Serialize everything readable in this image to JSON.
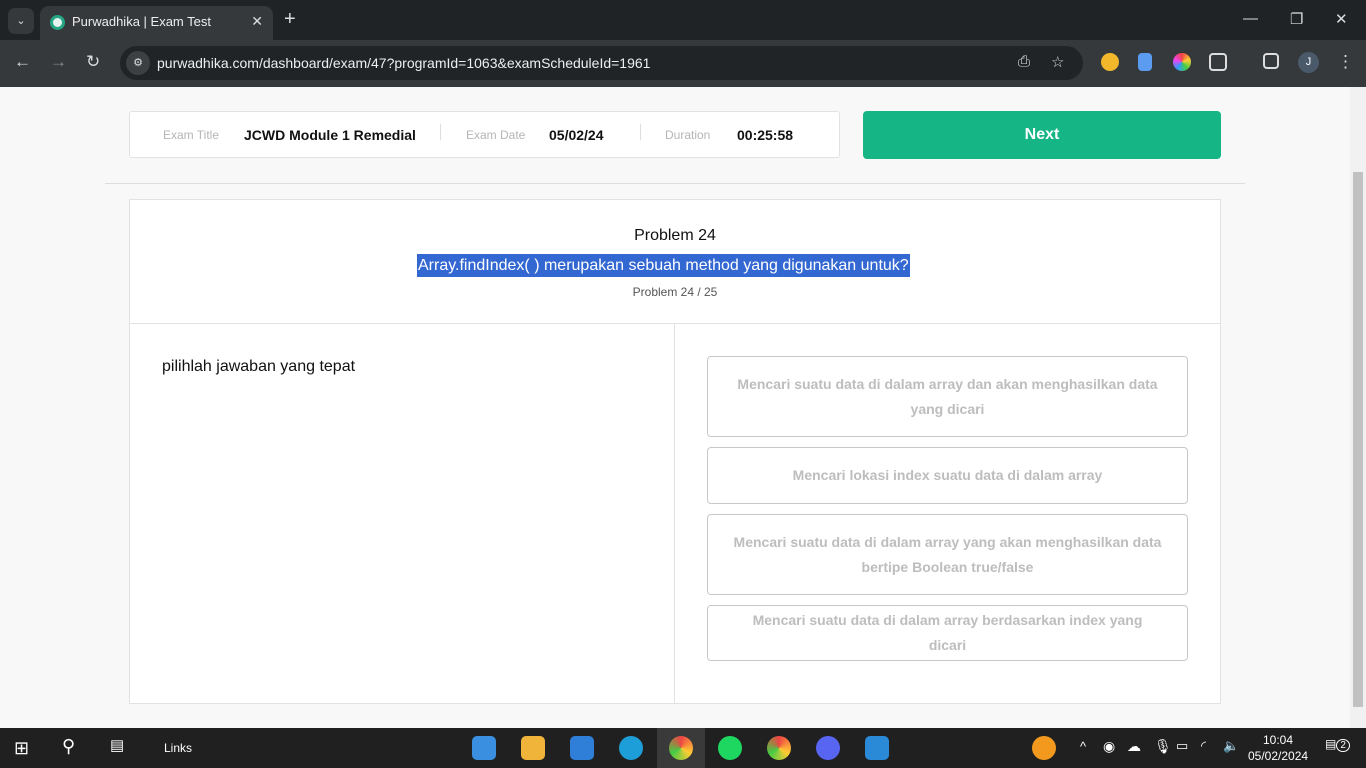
{
  "browser": {
    "tab_title": "Purwadhika | Exam Test",
    "url": "purwadhika.com/dashboard/exam/47?programId=1063&examScheduleId=1961",
    "profile_initial": "J"
  },
  "exam": {
    "title_label": "Exam Title",
    "title": "JCWD Module 1 Remedial",
    "date_label": "Exam Date",
    "date": "05/02/24",
    "duration_label": "Duration",
    "duration": "00:25:58",
    "next_label": "Next"
  },
  "question": {
    "heading": "Problem 24",
    "text": "Array.findIndex( ) merupakan sebuah method yang digunakan untuk?",
    "progress": "Problem 24 / 25",
    "instruction": "pilihlah jawaban yang tepat",
    "options": [
      "Mencari suatu data di dalam array dan akan menghasilkan data yang dicari",
      "Mencari lokasi index suatu data di dalam array",
      "Mencari suatu data di dalam array yang akan menghasilkan data bertipe Boolean true/false",
      "Mencari suatu data di dalam array berdasarkan index yang dicari"
    ]
  },
  "taskbar": {
    "links_label": "Links",
    "time": "10:04",
    "date": "05/02/2024",
    "notifications": "2"
  },
  "colors": {
    "accent": "#15b585",
    "selection": "#3367d1"
  }
}
